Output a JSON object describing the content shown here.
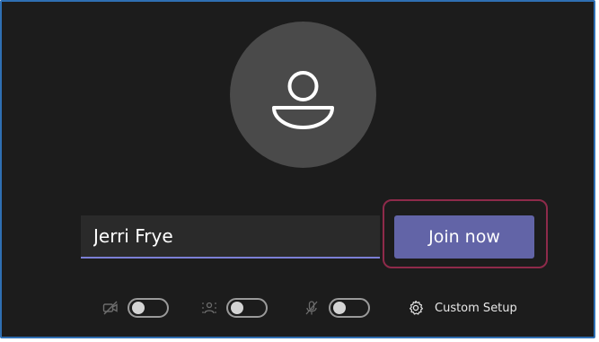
{
  "prejoin": {
    "name_value": "Jerri Frye",
    "join_label": "Join now",
    "custom_setup_label": "Custom Setup"
  },
  "controls": [
    {
      "icon": "camera-off-icon",
      "state": "off"
    },
    {
      "icon": "blur-background-icon",
      "state": "off"
    },
    {
      "icon": "microphone-off-icon",
      "state": "off"
    }
  ],
  "colors": {
    "background": "#1c1c1c",
    "avatar": "#4a4a4a",
    "accent": "#6264a7",
    "highlight_border": "#8e2a4a",
    "frame_border": "#2f6fb3"
  }
}
